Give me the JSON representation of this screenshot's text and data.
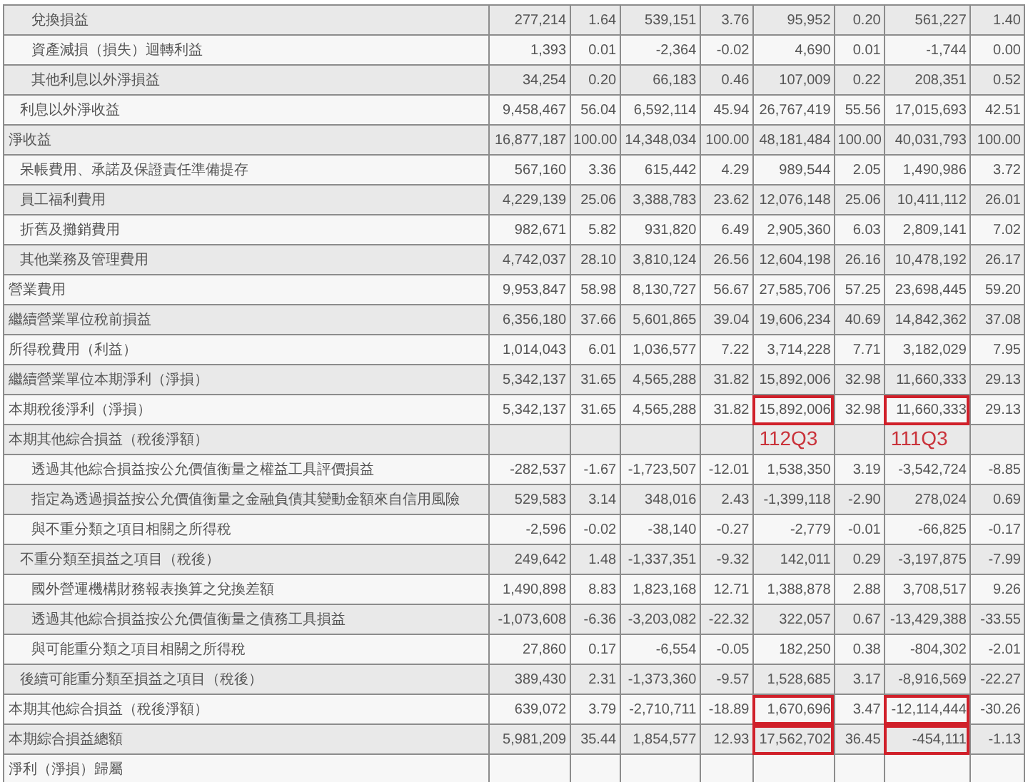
{
  "rows": [
    {
      "label": "淨收益",
      "cells": [
        {
          "v": "16,877,187",
          "boxed": false
        },
        {
          "v": "100.00",
          "boxed": false
        },
        {
          "v": "14,348,034",
          "boxed": false
        },
        {
          "v": "100.00",
          "boxed": false
        },
        {
          "v": "48,181,484",
          "boxed": false
        },
        {
          "v": "100.00",
          "boxed": false
        },
        {
          "v": "40,031,793",
          "boxed": false
        },
        {
          "v": "100.00",
          "boxed": false
        }
      ],
      "children": [
        {
          "label": "利息以外淨收益",
          "cells": [
            {
              "v": "9,458,467",
              "boxed": false
            },
            {
              "v": "56.04",
              "boxed": false
            },
            {
              "v": "6,592,114",
              "boxed": false
            },
            {
              "v": "45.94",
              "boxed": false
            },
            {
              "v": "26,767,419",
              "boxed": false
            },
            {
              "v": "55.56",
              "boxed": false
            },
            {
              "v": "17,015,693",
              "boxed": false
            },
            {
              "v": "42.51",
              "boxed": false
            }
          ],
          "children": [
            {
              "label": "兌換損益",
              "cells": [
                {
                  "v": "277,214",
                  "boxed": false
                },
                {
                  "v": "1.64",
                  "boxed": false
                },
                {
                  "v": "539,151",
                  "boxed": false
                },
                {
                  "v": "3.76",
                  "boxed": false
                },
                {
                  "v": "95,952",
                  "boxed": false
                },
                {
                  "v": "0.20",
                  "boxed": false
                },
                {
                  "v": "561,227",
                  "boxed": false
                },
                {
                  "v": "1.40",
                  "boxed": false
                }
              ]
            },
            {
              "label": "資產減損（損失）迴轉利益",
              "cells": [
                {
                  "v": "1,393",
                  "boxed": false
                },
                {
                  "v": "0.01",
                  "boxed": false
                },
                {
                  "v": "-2,364",
                  "boxed": false
                },
                {
                  "v": "-0.02",
                  "boxed": false
                },
                {
                  "v": "4,690",
                  "boxed": false
                },
                {
                  "v": "0.01",
                  "boxed": false
                },
                {
                  "v": "-1,744",
                  "boxed": false
                },
                {
                  "v": "0.00",
                  "boxed": false
                }
              ]
            },
            {
              "label": "其他利息以外淨損益",
              "cells": [
                {
                  "v": "34,254",
                  "boxed": false
                },
                {
                  "v": "0.20",
                  "boxed": false
                },
                {
                  "v": "66,183",
                  "boxed": false
                },
                {
                  "v": "0.46",
                  "boxed": false
                },
                {
                  "v": "107,009",
                  "boxed": false
                },
                {
                  "v": "0.22",
                  "boxed": false
                },
                {
                  "v": "208,351",
                  "boxed": false
                },
                {
                  "v": "0.52",
                  "boxed": false
                }
              ]
            }
          ]
        }
      ]
    },
    {
      "label": "營業費用",
      "cells": [
        {
          "v": "9,953,847",
          "boxed": false
        },
        {
          "v": "58.98",
          "boxed": false
        },
        {
          "v": "8,130,727",
          "boxed": false
        },
        {
          "v": "56.67",
          "boxed": false
        },
        {
          "v": "27,585,706",
          "boxed": false
        },
        {
          "v": "57.25",
          "boxed": false
        },
        {
          "v": "23,698,445",
          "boxed": false
        },
        {
          "v": "59.20",
          "boxed": false
        }
      ],
      "children": [
        {
          "label": "呆帳費用、承諾及保證責任準備提存",
          "cells": [
            {
              "v": "567,160",
              "boxed": false
            },
            {
              "v": "3.36",
              "boxed": false
            },
            {
              "v": "615,442",
              "boxed": false
            },
            {
              "v": "4.29",
              "boxed": false
            },
            {
              "v": "989,544",
              "boxed": false
            },
            {
              "v": "2.05",
              "boxed": false
            },
            {
              "v": "1,490,986",
              "boxed": false
            },
            {
              "v": "3.72",
              "boxed": false
            }
          ]
        },
        {
          "label": "員工福利費用",
          "cells": [
            {
              "v": "4,229,139",
              "boxed": false
            },
            {
              "v": "25.06",
              "boxed": false
            },
            {
              "v": "3,388,783",
              "boxed": false
            },
            {
              "v": "23.62",
              "boxed": false
            },
            {
              "v": "12,076,148",
              "boxed": false
            },
            {
              "v": "25.06",
              "boxed": false
            },
            {
              "v": "10,411,112",
              "boxed": false
            },
            {
              "v": "26.01",
              "boxed": false
            }
          ]
        },
        {
          "label": "折舊及攤銷費用",
          "cells": [
            {
              "v": "982,671",
              "boxed": false
            },
            {
              "v": "5.82",
              "boxed": false
            },
            {
              "v": "931,820",
              "boxed": false
            },
            {
              "v": "6.49",
              "boxed": false
            },
            {
              "v": "2,905,360",
              "boxed": false
            },
            {
              "v": "6.03",
              "boxed": false
            },
            {
              "v": "2,809,141",
              "boxed": false
            },
            {
              "v": "7.02",
              "boxed": false
            }
          ]
        },
        {
          "label": "其他業務及管理費用",
          "cells": [
            {
              "v": "4,742,037",
              "boxed": false
            },
            {
              "v": "28.10",
              "boxed": false
            },
            {
              "v": "3,810,124",
              "boxed": false
            },
            {
              "v": "26.56",
              "boxed": false
            },
            {
              "v": "12,604,198",
              "boxed": false
            },
            {
              "v": "26.16",
              "boxed": false
            },
            {
              "v": "10,478,192",
              "boxed": false
            },
            {
              "v": "26.17",
              "boxed": false
            }
          ]
        }
      ]
    },
    {
      "label": "繼續營業單位稅前損益",
      "cells": [
        {
          "v": "6,356,180",
          "boxed": false
        },
        {
          "v": "37.66",
          "boxed": false
        },
        {
          "v": "5,601,865",
          "boxed": false
        },
        {
          "v": "39.04",
          "boxed": false
        },
        {
          "v": "19,606,234",
          "boxed": false
        },
        {
          "v": "40.69",
          "boxed": false
        },
        {
          "v": "14,842,362",
          "boxed": false
        },
        {
          "v": "37.08",
          "boxed": false
        }
      ]
    },
    {
      "label": "所得稅費用（利益）",
      "cells": [
        {
          "v": "1,014,043",
          "boxed": false
        },
        {
          "v": "6.01",
          "boxed": false
        },
        {
          "v": "1,036,577",
          "boxed": false
        },
        {
          "v": "7.22",
          "boxed": false
        },
        {
          "v": "3,714,228",
          "boxed": false
        },
        {
          "v": "7.71",
          "boxed": false
        },
        {
          "v": "3,182,029",
          "boxed": false
        },
        {
          "v": "7.95",
          "boxed": false
        }
      ]
    },
    {
      "label": "繼續營業單位本期淨利（淨損）",
      "cells": [
        {
          "v": "5,342,137",
          "boxed": false
        },
        {
          "v": "31.65",
          "boxed": false
        },
        {
          "v": "4,565,288",
          "boxed": false
        },
        {
          "v": "31.82",
          "boxed": false
        },
        {
          "v": "15,892,006",
          "boxed": false
        },
        {
          "v": "32.98",
          "boxed": false
        },
        {
          "v": "11,660,333",
          "boxed": false
        },
        {
          "v": "29.13",
          "boxed": false
        }
      ]
    },
    {
      "label": "本期稅後淨利（淨損）",
      "cells": [
        {
          "v": "5,342,137",
          "boxed": false
        },
        {
          "v": "31.65",
          "boxed": false
        },
        {
          "v": "4,565,288",
          "boxed": false
        },
        {
          "v": "31.82",
          "boxed": false
        },
        {
          "v": "15,892,006",
          "boxed": true
        },
        {
          "v": "32.98",
          "boxed": false
        },
        {
          "v": "11,660,333",
          "boxed": true
        },
        {
          "v": "29.13",
          "boxed": false
        }
      ]
    },
    {
      "label": "本期其他綜合損益（稅後淨額）",
      "cells": [
        {
          "boxed": false
        },
        {
          "boxed": false
        },
        {
          "boxed": false
        },
        {
          "boxed": false
        },
        {
          "note": "112Q3",
          "boxed": false
        },
        {
          "boxed": false
        },
        {
          "note": "111Q3",
          "boxed": false
        },
        {
          "boxed": false
        }
      ]
    },
    {
      "label": "本期其他綜合損益（稅後淨額）",
      "cells": [
        {
          "v": "639,072",
          "boxed": false
        },
        {
          "v": "3.79",
          "boxed": false
        },
        {
          "v": "-2,710,711",
          "boxed": false
        },
        {
          "v": "-18.89",
          "boxed": false
        },
        {
          "v": "1,670,696",
          "boxed": true
        },
        {
          "v": "3.47",
          "boxed": false
        },
        {
          "v": "-12,114,444",
          "boxed": true
        },
        {
          "v": "-30.26",
          "boxed": false
        }
      ],
      "children": [
        {
          "label": "不重分類至損益之項目（稅後）",
          "cells": [
            {
              "v": "249,642",
              "boxed": false
            },
            {
              "v": "1.48",
              "boxed": false
            },
            {
              "v": "-1,337,351",
              "boxed": false
            },
            {
              "v": "-9.32",
              "boxed": false
            },
            {
              "v": "142,011",
              "boxed": false
            },
            {
              "v": "0.29",
              "boxed": false
            },
            {
              "v": "-3,197,875",
              "boxed": false
            },
            {
              "v": "-7.99",
              "boxed": false
            }
          ],
          "children": [
            {
              "label": "透過其他綜合損益按公允價值衡量之權益工具評價損益",
              "cells": [
                {
                  "v": "-282,537",
                  "boxed": false
                },
                {
                  "v": "-1.67",
                  "boxed": false
                },
                {
                  "v": "-1,723,507",
                  "boxed": false
                },
                {
                  "v": "-12.01",
                  "boxed": false
                },
                {
                  "v": "1,538,350",
                  "boxed": false
                },
                {
                  "v": "3.19",
                  "boxed": false
                },
                {
                  "v": "-3,542,724",
                  "boxed": false
                },
                {
                  "v": "-8.85",
                  "boxed": false
                }
              ]
            },
            {
              "label": "指定為透過損益按公允價值衡量之金融負債其變動金額來自信用風險",
              "cells": [
                {
                  "v": "529,583",
                  "boxed": false
                },
                {
                  "v": "3.14",
                  "boxed": false
                },
                {
                  "v": "348,016",
                  "boxed": false
                },
                {
                  "v": "2.43",
                  "boxed": false
                },
                {
                  "v": "-1,399,118",
                  "boxed": false
                },
                {
                  "v": "-2.90",
                  "boxed": false
                },
                {
                  "v": "278,024",
                  "boxed": false
                },
                {
                  "v": "0.69",
                  "boxed": false
                }
              ]
            },
            {
              "label": "與不重分類之項目相關之所得稅",
              "cells": [
                {
                  "v": "-2,596",
                  "boxed": false
                },
                {
                  "v": "-0.02",
                  "boxed": false
                },
                {
                  "v": "-38,140",
                  "boxed": false
                },
                {
                  "v": "-0.27",
                  "boxed": false
                },
                {
                  "v": "-2,779",
                  "boxed": false
                },
                {
                  "v": "-0.01",
                  "boxed": false
                },
                {
                  "v": "-66,825",
                  "boxed": false
                },
                {
                  "v": "-0.17",
                  "boxed": false
                }
              ]
            }
          ]
        },
        {
          "label": "後續可能重分類至損益之項目（稅後）",
          "cells": [
            {
              "v": "389,430",
              "boxed": false
            },
            {
              "v": "2.31",
              "boxed": false
            },
            {
              "v": "-1,373,360",
              "boxed": false
            },
            {
              "v": "-9.57",
              "boxed": false
            },
            {
              "v": "1,528,685",
              "boxed": false
            },
            {
              "v": "3.17",
              "boxed": false
            },
            {
              "v": "-8,916,569",
              "boxed": false
            },
            {
              "v": "-22.27",
              "boxed": false
            }
          ],
          "children": [
            {
              "label": "國外營運機構財務報表換算之兌換差額",
              "cells": [
                {
                  "v": "1,490,898",
                  "boxed": false
                },
                {
                  "v": "8.83",
                  "boxed": false
                },
                {
                  "v": "1,823,168",
                  "boxed": false
                },
                {
                  "v": "12.71",
                  "boxed": false
                },
                {
                  "v": "1,388,878",
                  "boxed": false
                },
                {
                  "v": "2.88",
                  "boxed": false
                },
                {
                  "v": "3,708,517",
                  "boxed": false
                },
                {
                  "v": "9.26",
                  "boxed": false
                }
              ]
            },
            {
              "label": "透過其他綜合損益按公允價值衡量之債務工具損益",
              "cells": [
                {
                  "v": "-1,073,608",
                  "boxed": false
                },
                {
                  "v": "-6.36",
                  "boxed": false
                },
                {
                  "v": "-3,203,082",
                  "boxed": false
                },
                {
                  "v": "-22.32",
                  "boxed": false
                },
                {
                  "v": "322,057",
                  "boxed": false
                },
                {
                  "v": "0.67",
                  "boxed": false
                },
                {
                  "v": "-13,429,388",
                  "boxed": false
                },
                {
                  "v": "-33.55",
                  "boxed": false
                }
              ]
            },
            {
              "label": "與可能重分類之項目相關之所得稅",
              "cells": [
                {
                  "v": "27,860",
                  "boxed": false
                },
                {
                  "v": "0.17",
                  "boxed": false
                },
                {
                  "v": "-6,554",
                  "boxed": false
                },
                {
                  "v": "-0.05",
                  "boxed": false
                },
                {
                  "v": "182,250",
                  "boxed": false
                },
                {
                  "v": "0.38",
                  "boxed": false
                },
                {
                  "v": "-804,302",
                  "boxed": false
                },
                {
                  "v": "-2.01",
                  "boxed": false
                }
              ]
            }
          ]
        }
      ]
    },
    {
      "label": "本期綜合損益總額",
      "cells": [
        {
          "v": "5,981,209",
          "boxed": false
        },
        {
          "v": "35.44",
          "boxed": false
        },
        {
          "v": "1,854,577",
          "boxed": false
        },
        {
          "v": "12.93",
          "boxed": false
        },
        {
          "v": "17,562,702",
          "boxed": true
        },
        {
          "v": "36.45",
          "boxed": false
        },
        {
          "v": "-454,111",
          "boxed": true
        },
        {
          "v": "-1.13",
          "boxed": false
        }
      ]
    },
    {
      "label": "淨利（淨損）歸屬",
      "cells": [
        {
          "boxed": false
        },
        {
          "boxed": false
        },
        {
          "boxed": false
        },
        {
          "boxed": false
        },
        {
          "boxed": false
        },
        {
          "boxed": false
        },
        {
          "boxed": false
        },
        {
          "boxed": false
        }
      ]
    }
  ]
}
